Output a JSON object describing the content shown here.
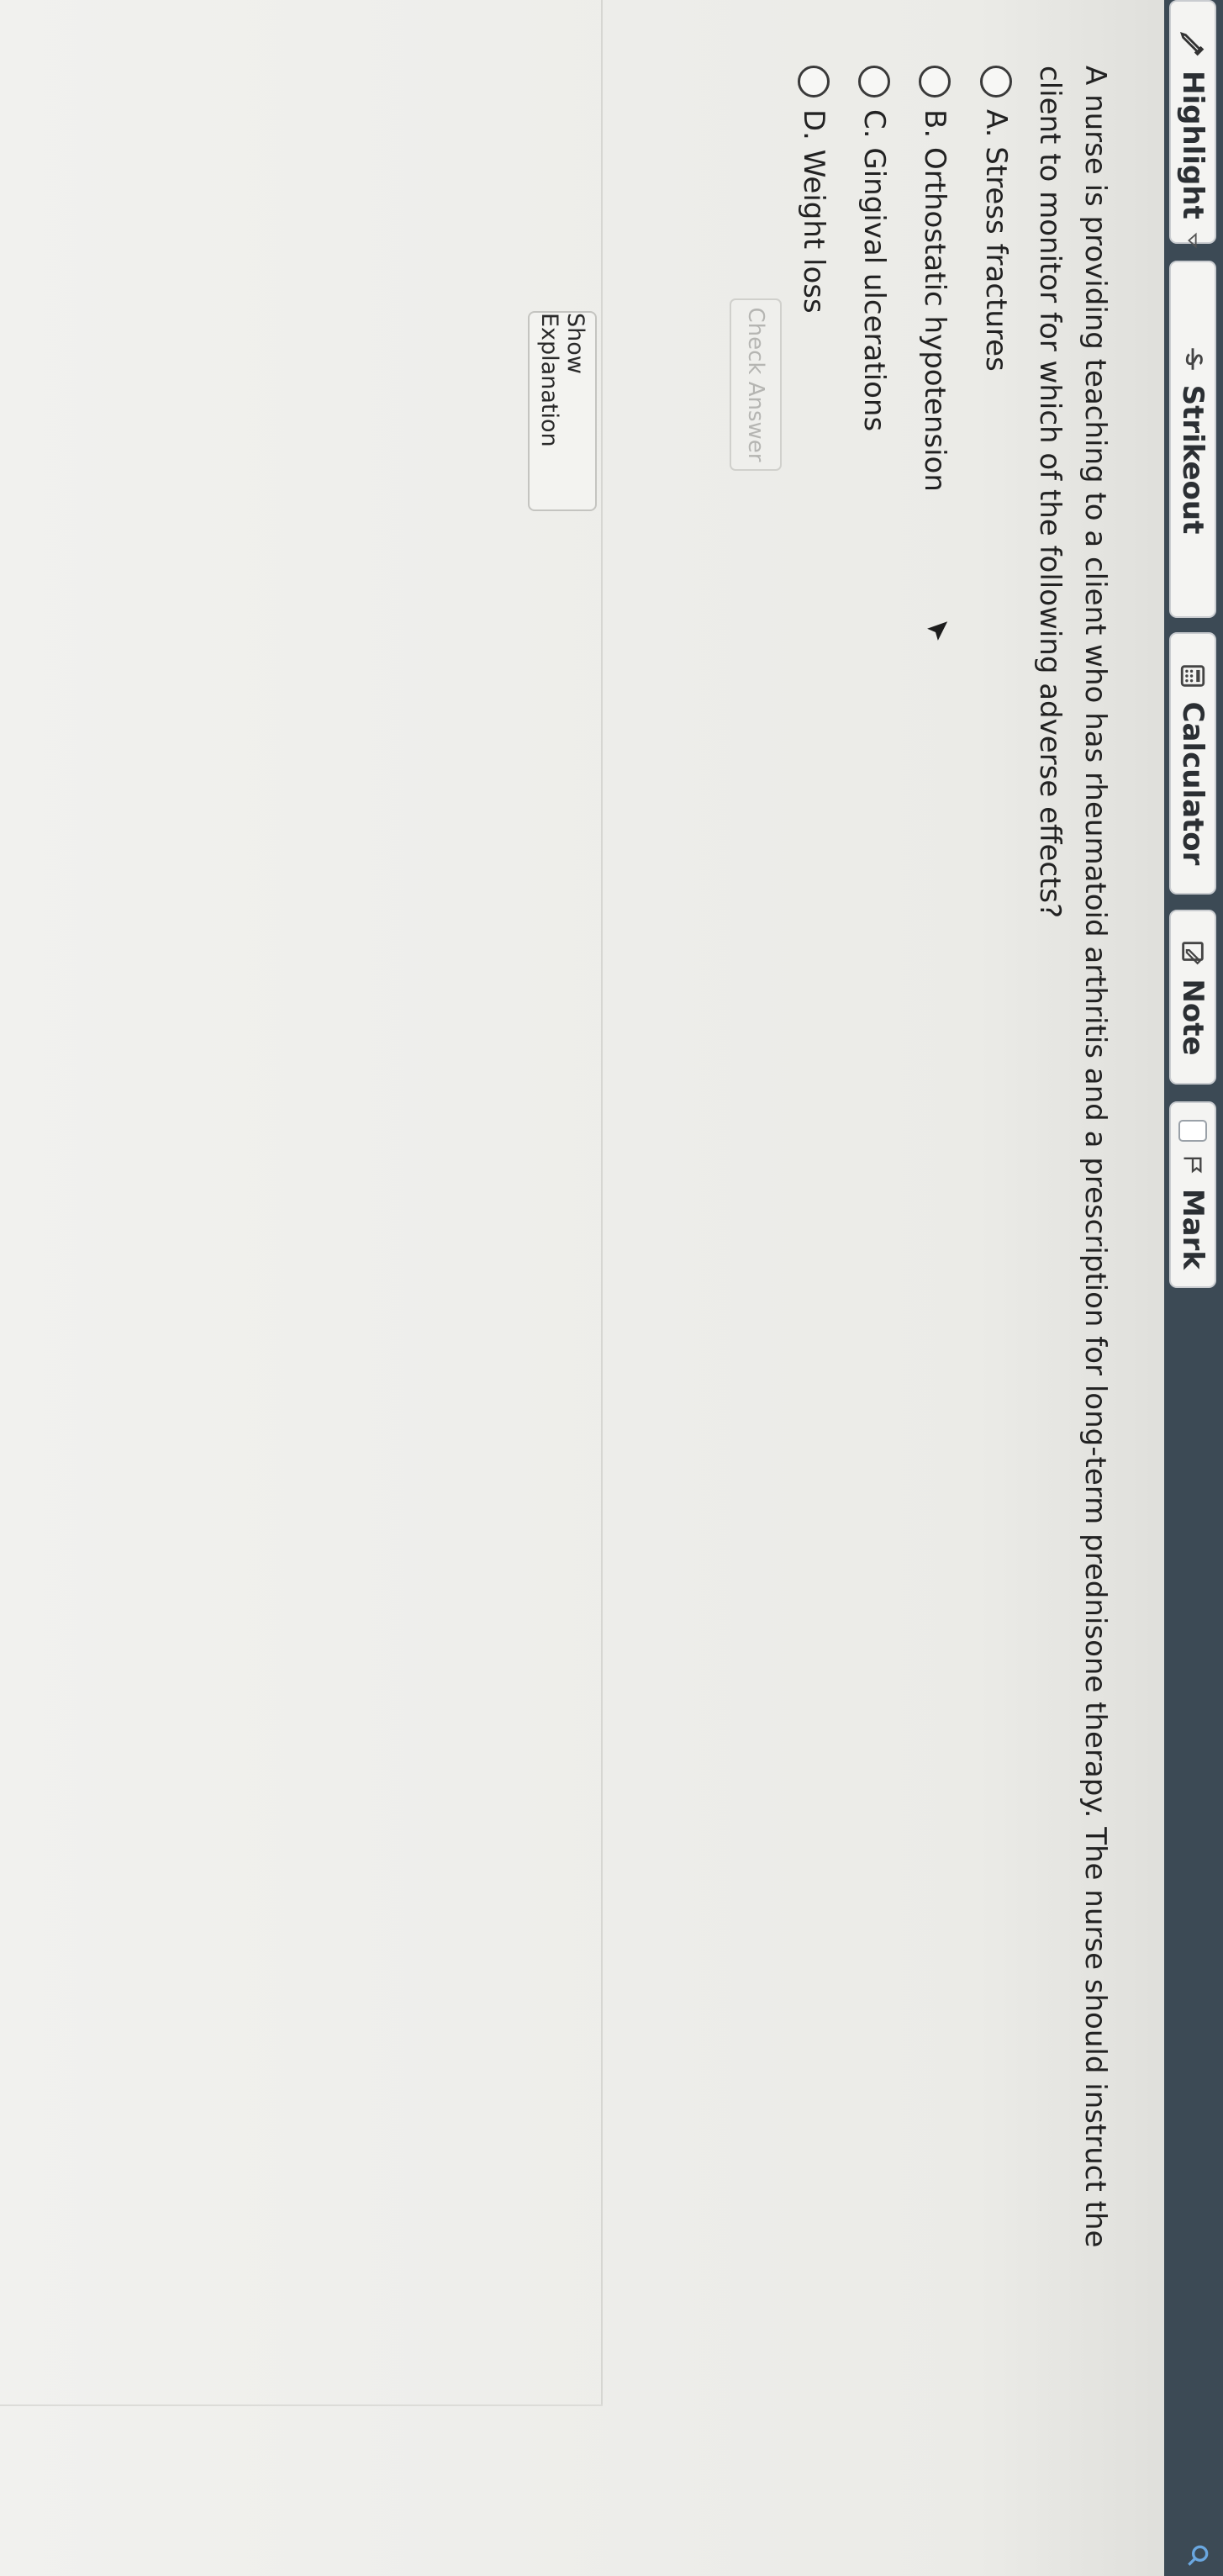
{
  "toolbar": {
    "highlight_label": "Highlight",
    "strikeout_label": "Strikeout",
    "calculator_label": "Calculator",
    "note_label": "Note",
    "mark_label": "Mark",
    "icons": [
      "pencil-icon",
      "chevron-down-icon",
      "strikeout-icon",
      "calculator-icon",
      "note-icon",
      "checkbox-icon",
      "flag-icon",
      "search-icon"
    ]
  },
  "question": {
    "text": "A nurse is providing teaching to a client who has rheumatoid arthritis and a prescription for long-term prednisone therapy. The nurse should instruct the client to monitor for which of the following adverse effects?"
  },
  "choices": [
    {
      "label": "A. Stress fractures"
    },
    {
      "label": "B. Orthostatic hypotension"
    },
    {
      "label": "C. Gingival ulcerations"
    },
    {
      "label": "D. Weight loss"
    }
  ],
  "actions": {
    "check_answer_label": "Check Answer",
    "show_explanation_label": "Show Explanation"
  },
  "colors": {
    "toolbar_bg": "#3c4a55",
    "search_icon": "#6aa7e0"
  }
}
